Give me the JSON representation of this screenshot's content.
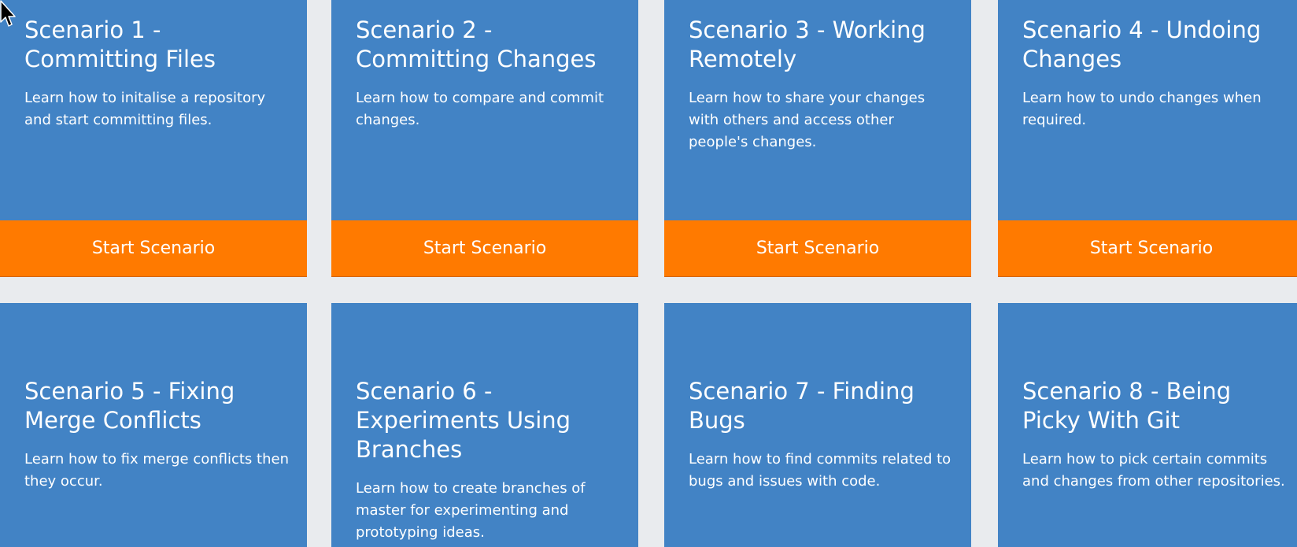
{
  "colors": {
    "background": "#e9ebee",
    "card": "#4283c5",
    "button": "#ff7a00",
    "text": "#ffffff"
  },
  "scenarios": [
    {
      "title": "Scenario 1 - Committing Files",
      "description": "Learn how to initalise a repository and start committing files.",
      "button": "Start Scenario"
    },
    {
      "title": "Scenario 2 - Committing Changes",
      "description": "Learn how to compare and commit changes.",
      "button": "Start Scenario"
    },
    {
      "title": "Scenario 3 - Working Remotely",
      "description": "Learn how to share your changes with others and access other people's changes.",
      "button": "Start Scenario"
    },
    {
      "title": "Scenario 4 - Undoing Changes",
      "description": "Learn how to undo changes when required.",
      "button": "Start Scenario"
    },
    {
      "title": "Scenario 5 - Fixing Merge Conflicts",
      "description": "Learn how to fix merge conflicts then they occur."
    },
    {
      "title": "Scenario 6 - Experiments Using Branches",
      "description": "Learn how to create branches of master for experimenting and prototyping ideas."
    },
    {
      "title": "Scenario 7 - Finding Bugs",
      "description": "Learn how to find commits related to bugs and issues with code."
    },
    {
      "title": "Scenario 8 - Being Picky With Git",
      "description": "Learn how to pick certain commits and changes from other repositories."
    }
  ],
  "cursor_icon": "mouse-pointer-icon"
}
